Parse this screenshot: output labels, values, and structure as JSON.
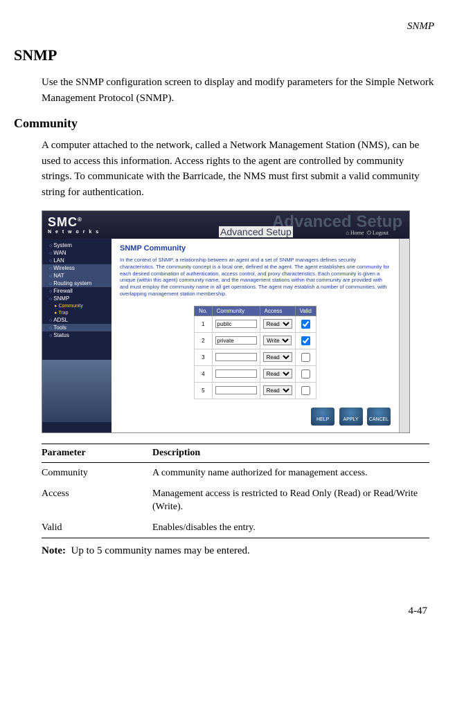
{
  "running_head": "SNMP",
  "h1": "SNMP",
  "intro": "Use the SNMP configuration screen to display and modify parameters for the Simple Network Management Protocol (SNMP).",
  "h2": "Community",
  "community_para": "A computer attached to the network, called a Network Management Station (NMS), can be used to access this information. Access rights to the agent are controlled by community strings. To communicate with the Barricade, the NMS must first submit a valid community string for authentication.",
  "screenshot": {
    "logo": "SMC",
    "logo_reg": "®",
    "logo_sub": "N e t w o r k s",
    "ghost_title": "Advanced Setup",
    "subtitle": "Advanced Setup",
    "toplinks": {
      "home": "Home",
      "logout": "Logout"
    },
    "sidebar": [
      {
        "label": "System",
        "type": "lev1"
      },
      {
        "label": "WAN",
        "type": "lev1"
      },
      {
        "label": "LAN",
        "type": "lev1"
      },
      {
        "label": "Wireless",
        "type": "lev1 highlight"
      },
      {
        "label": "NAT",
        "type": "lev1 highlight"
      },
      {
        "label": "Routing system",
        "type": "lev1 highlight"
      },
      {
        "label": "Firewall",
        "type": "lev1"
      },
      {
        "label": "SNMP",
        "type": "lev1"
      },
      {
        "label": "Community",
        "type": "sub"
      },
      {
        "label": "Trap",
        "type": "sub"
      },
      {
        "label": "ADSL",
        "type": "lev1"
      },
      {
        "label": "Tools",
        "type": "lev1 highlight"
      },
      {
        "label": "Status",
        "type": "lev1"
      }
    ],
    "content_title": "SNMP Community",
    "content_desc": "In the context of SNMP, a relationship between an agent and a set of SNMP managers defines security characteristics. The community concept is a local one, defined at the agent. The agent establishes one community for each desired combination of authentication, access control, and proxy characteristics. Each community is given a unique (within this agent) community name, and the management stations within that community are provided with and must employ the community name in all get operations. The agent may establish a number of communities, with overlapping management station membership.",
    "table": {
      "headers": {
        "no": "No.",
        "community": "Community",
        "access": "Access",
        "valid": "Valid"
      },
      "rows": [
        {
          "no": "1",
          "community": "public",
          "access": "Read",
          "valid": true
        },
        {
          "no": "2",
          "community": "private",
          "access": "Write",
          "valid": true
        },
        {
          "no": "3",
          "community": "",
          "access": "Read",
          "valid": false
        },
        {
          "no": "4",
          "community": "",
          "access": "Read",
          "valid": false
        },
        {
          "no": "5",
          "community": "",
          "access": "Read",
          "valid": false
        }
      ]
    },
    "buttons": {
      "help": "HELP",
      "apply": "APPLY",
      "cancel": "CANCEL"
    }
  },
  "param_table": {
    "header": {
      "param": "Parameter",
      "desc": "Description"
    },
    "rows": [
      {
        "param": "Community",
        "desc": "A community name authorized for management access."
      },
      {
        "param": "Access",
        "desc": "Management access is restricted to Read Only (Read) or Read/Write (Write)."
      },
      {
        "param": "Valid",
        "desc": "Enables/disables the entry."
      }
    ]
  },
  "note_label": "Note:",
  "note_text": "Up to 5 community names may be entered.",
  "page_num": "4-47"
}
